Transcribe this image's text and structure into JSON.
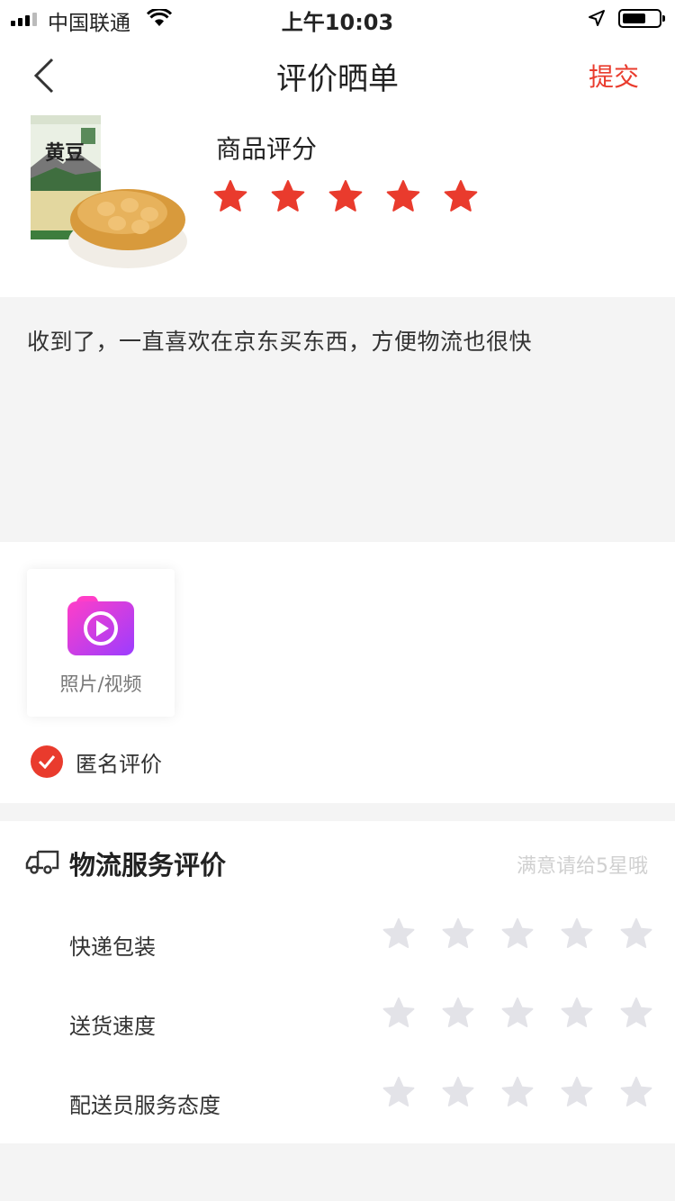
{
  "status_bar": {
    "carrier": "中国联通",
    "time": "上午10:03"
  },
  "nav": {
    "title": "评价晒单",
    "submit_label": "提交"
  },
  "product": {
    "package_text": "黄豆",
    "rating_title": "商品评分",
    "rating": 5,
    "max_rating": 5,
    "star_color": "#e93b2d"
  },
  "comment": {
    "text": "收到了，一直喜欢在京东买东西，方便物流也很快"
  },
  "media": {
    "upload_label": "照片/视频",
    "anonymous_label": "匿名评价",
    "anonymous_checked": true
  },
  "logistics": {
    "title": "物流服务评价",
    "hint": "满意请给5星哦",
    "empty_star_color": "#e3e3e8",
    "rows": [
      {
        "label": "快递包装",
        "rating": 0
      },
      {
        "label": "送货速度",
        "rating": 0
      },
      {
        "label": "配送员服务态度",
        "rating": 0
      }
    ]
  }
}
